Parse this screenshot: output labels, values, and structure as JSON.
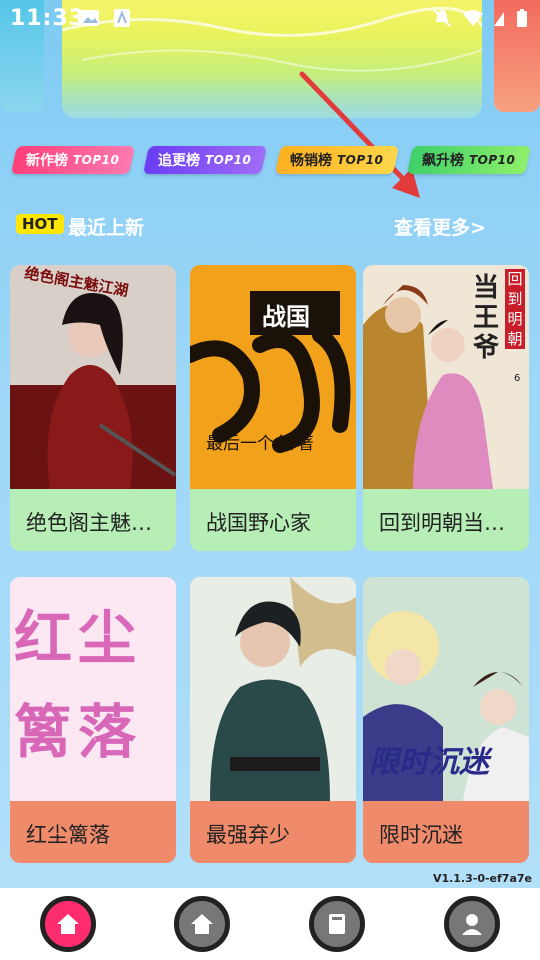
{
  "status_bar": {
    "time": "11:33"
  },
  "ranks": [
    {
      "label": "新作榜",
      "sub": "TOP10"
    },
    {
      "label": "追更榜",
      "sub": "TOP10"
    },
    {
      "label": "畅销榜",
      "sub": "TOP10"
    },
    {
      "label": "飙升榜",
      "sub": "TOP10"
    }
  ],
  "section": {
    "badge": "HOT",
    "title": "最近上新",
    "more": "查看更多>"
  },
  "books": [
    {
      "title": "绝色阁主魅…",
      "cover_text": "绝色阁主魅江湖"
    },
    {
      "title": "战国野心家",
      "cover_text": "战国",
      "cover_author": "最后一个名/著"
    },
    {
      "title": "回到明朝当…",
      "cover_text": "当王爷",
      "cover_side": "回到明朝",
      "cover_num": "6"
    },
    {
      "title": "红尘篱落",
      "cover_text": "红尘篱落"
    },
    {
      "title": "最强弃少"
    },
    {
      "title": "限时沉迷",
      "cover_text": "限时沉迷"
    }
  ],
  "version": "V1.1.3-0-ef7a7e",
  "tabs": [
    "home-active",
    "home",
    "bookshelf",
    "profile"
  ]
}
